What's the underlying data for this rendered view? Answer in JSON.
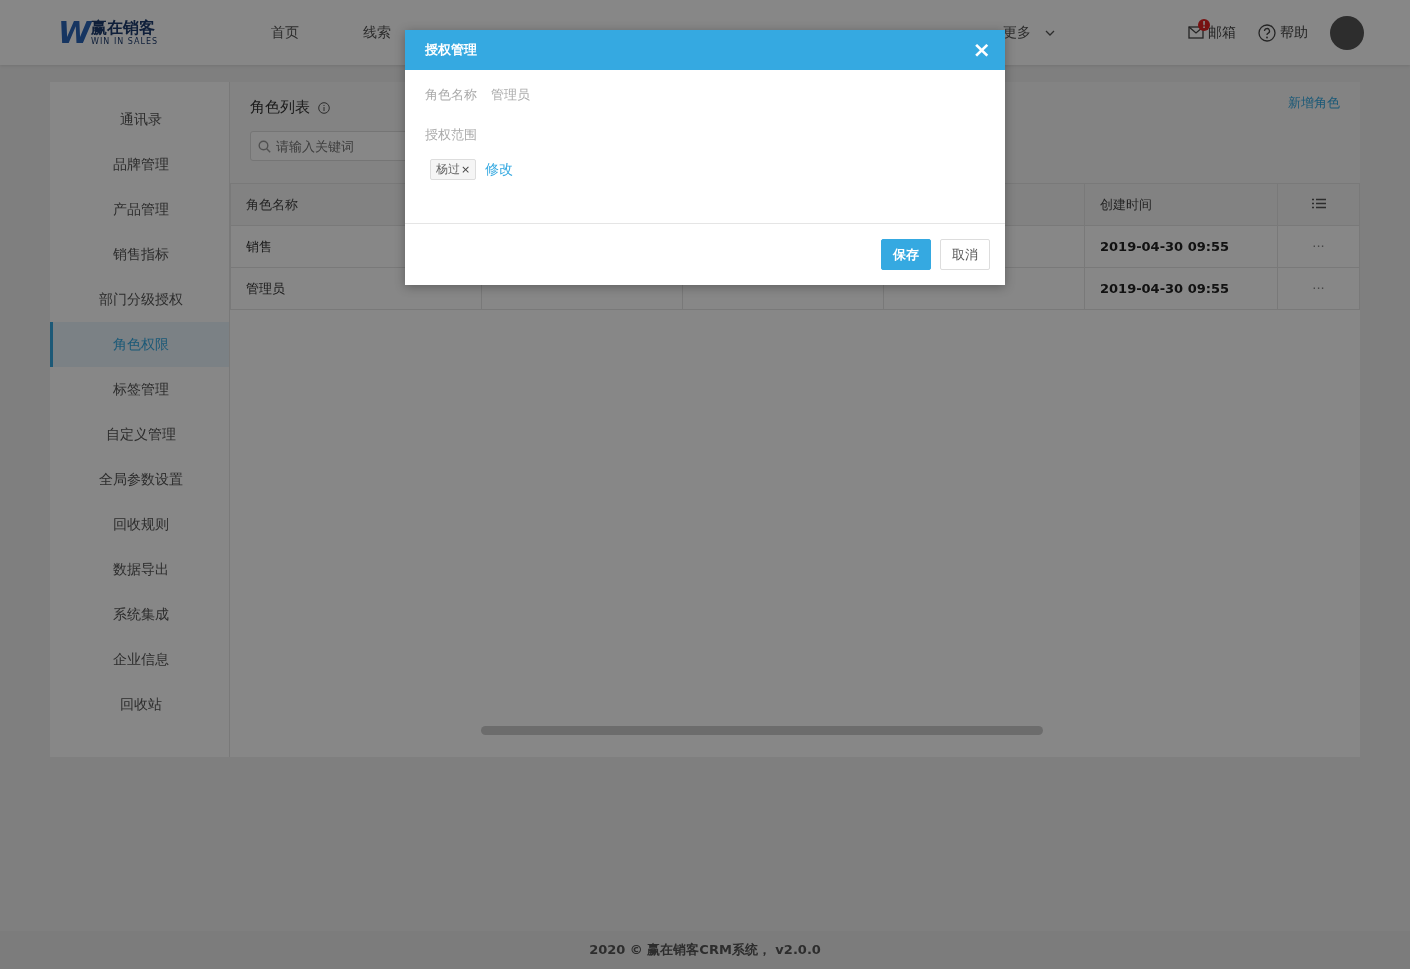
{
  "header": {
    "logo_mark": "W",
    "logo_title": "赢在销客",
    "logo_subtitle": "WIN IN SALES",
    "nav": [
      {
        "label": "首页"
      },
      {
        "label": "线索"
      },
      {
        "label": "更多"
      }
    ],
    "mail": {
      "label": "邮箱",
      "badge": "!"
    },
    "help": {
      "label": "帮助"
    }
  },
  "sidebar": {
    "items": [
      {
        "label": "通讯录",
        "selected": false
      },
      {
        "label": "品牌管理",
        "selected": false
      },
      {
        "label": "产品管理",
        "selected": false
      },
      {
        "label": "销售指标",
        "selected": false
      },
      {
        "label": "部门分级授权",
        "selected": false
      },
      {
        "label": "角色权限",
        "selected": true
      },
      {
        "label": "标签管理",
        "selected": false
      },
      {
        "label": "自定义管理",
        "selected": false
      },
      {
        "label": "全局参数设置",
        "selected": false
      },
      {
        "label": "回收规则",
        "selected": false
      },
      {
        "label": "数据导出",
        "selected": false
      },
      {
        "label": "系统集成",
        "selected": false
      },
      {
        "label": "企业信息",
        "selected": false
      },
      {
        "label": "回收站",
        "selected": false
      }
    ]
  },
  "panel": {
    "title": "角色列表",
    "add_link": "新增角色",
    "search": {
      "placeholder": "请输入关键词"
    },
    "table": {
      "columns": [
        "角色名称",
        "创建时间"
      ],
      "rows": [
        {
          "name": "销售",
          "created": "2019-04-30 09:55",
          "more": "···"
        },
        {
          "name": "管理员",
          "created": "2019-04-30 09:55",
          "more": "···"
        }
      ]
    }
  },
  "dialog": {
    "title": "授权管理",
    "close": "×",
    "role_label": "角色名称",
    "role_value": "管理员",
    "scope_label": "授权范围",
    "tags": [
      {
        "label": "杨过",
        "remove": "×"
      }
    ],
    "edit_link": "修改",
    "buttons": [
      {
        "label": "保存",
        "kind": "primary"
      },
      {
        "label": "取消",
        "kind": "default"
      }
    ]
  },
  "footer": {
    "text": "2020 © 赢在销客CRM系统， v2.0.0"
  }
}
